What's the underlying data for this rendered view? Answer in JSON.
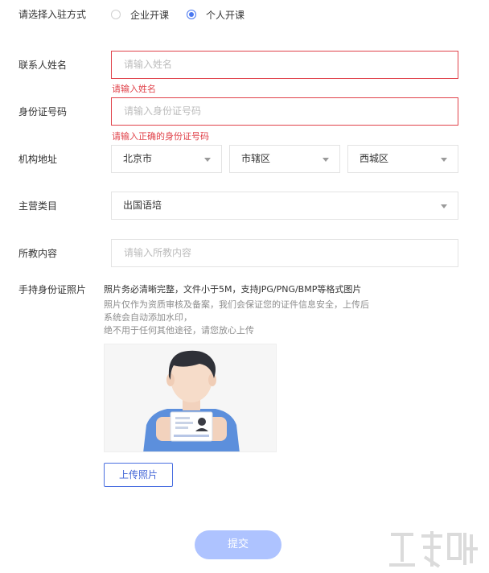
{
  "join_method": {
    "label": "请选择入驻方式",
    "options": [
      {
        "label": "企业开课",
        "checked": false
      },
      {
        "label": "个人开课",
        "checked": true
      }
    ]
  },
  "contact_name": {
    "label": "联系人姓名",
    "placeholder": "请输入姓名",
    "error": "请输入姓名"
  },
  "id_number": {
    "label": "身份证号码",
    "placeholder": "请输入身份证号码",
    "error": "请输入正确的身份证号码"
  },
  "address": {
    "label": "机构地址",
    "city": "北京市",
    "district": "市辖区",
    "area": "西城区"
  },
  "category": {
    "label": "主营类目",
    "value": "出国语培"
  },
  "teaching_content": {
    "label": "所教内容",
    "placeholder": "请输入所教内容"
  },
  "id_photo": {
    "label": "手持身份证照片",
    "requirement": "照片务必清晰完整，文件小于5M，支持JPG/PNG/BMP等格式图片",
    "privacy_line1": "照片仅作为资质审核及备案，我们会保证您的证件信息安全，上传后系统会自动添加水印，",
    "privacy_line2": "绝不用于任何其他途径，请您放心上传",
    "upload_label": "上传照片"
  },
  "submit_label": "提交",
  "colors": {
    "accent": "#4a78f0",
    "error": "#e0424a",
    "submit_bg": "#aec3ff"
  }
}
